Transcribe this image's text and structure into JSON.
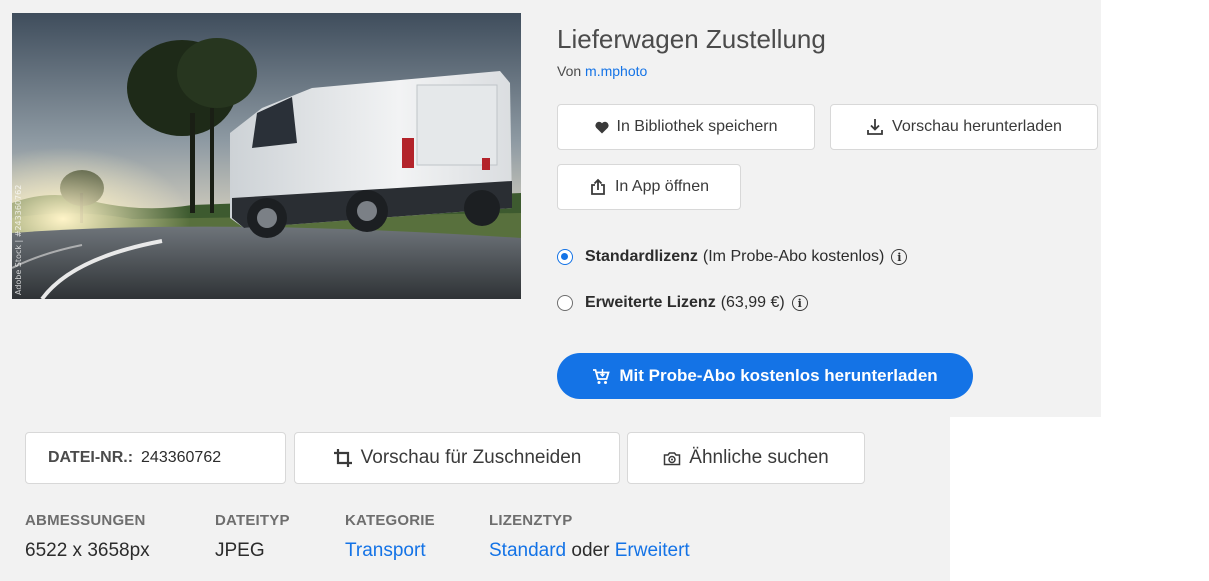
{
  "asset": {
    "title": "Lieferwagen Zustellung",
    "by_prefix": "Von",
    "author": "m.mphoto",
    "image_alt": "Weißer Lieferwagen auf Landstraße",
    "watermark": "Adobe Stock | #243360762"
  },
  "actions": {
    "save_library": "In Bibliothek speichern",
    "download_preview": "Vorschau herunterladen",
    "open_in_app": "In App öffnen"
  },
  "licenses": [
    {
      "name": "Standardlizenz",
      "detail": "(Im Probe-Abo kostenlos)",
      "selected": true
    },
    {
      "name": "Erweiterte Lizenz",
      "detail": "(63,99 €)",
      "selected": false
    }
  ],
  "cta": {
    "label": "Mit Probe-Abo kostenlos herunterladen"
  },
  "file": {
    "label": "DATEI-NR.:",
    "number": "243360762"
  },
  "tools": {
    "crop_preview": "Vorschau für Zuschneiden",
    "find_similar": "Ähnliche suchen"
  },
  "meta": {
    "dimensions": {
      "label": "ABMESSUNGEN",
      "value": "6522 x 3658px"
    },
    "filetype": {
      "label": "DATEITYP",
      "value": "JPEG"
    },
    "category": {
      "label": "KATEGORIE",
      "value": "Transport"
    },
    "licensetype": {
      "label": "LIZENZTYP",
      "value1": "Standard",
      "connector": "oder",
      "value2": "Erweitert"
    }
  },
  "colors": {
    "accent": "#1473e6",
    "panel_bg": "#f2f2f2",
    "text": "#2c2c2c"
  },
  "icons": {
    "heart": "heart-icon",
    "download": "download-icon",
    "share": "share-icon",
    "cart": "cart-icon",
    "crop": "crop-icon",
    "camera": "camera-icon",
    "info": "info-icon"
  }
}
